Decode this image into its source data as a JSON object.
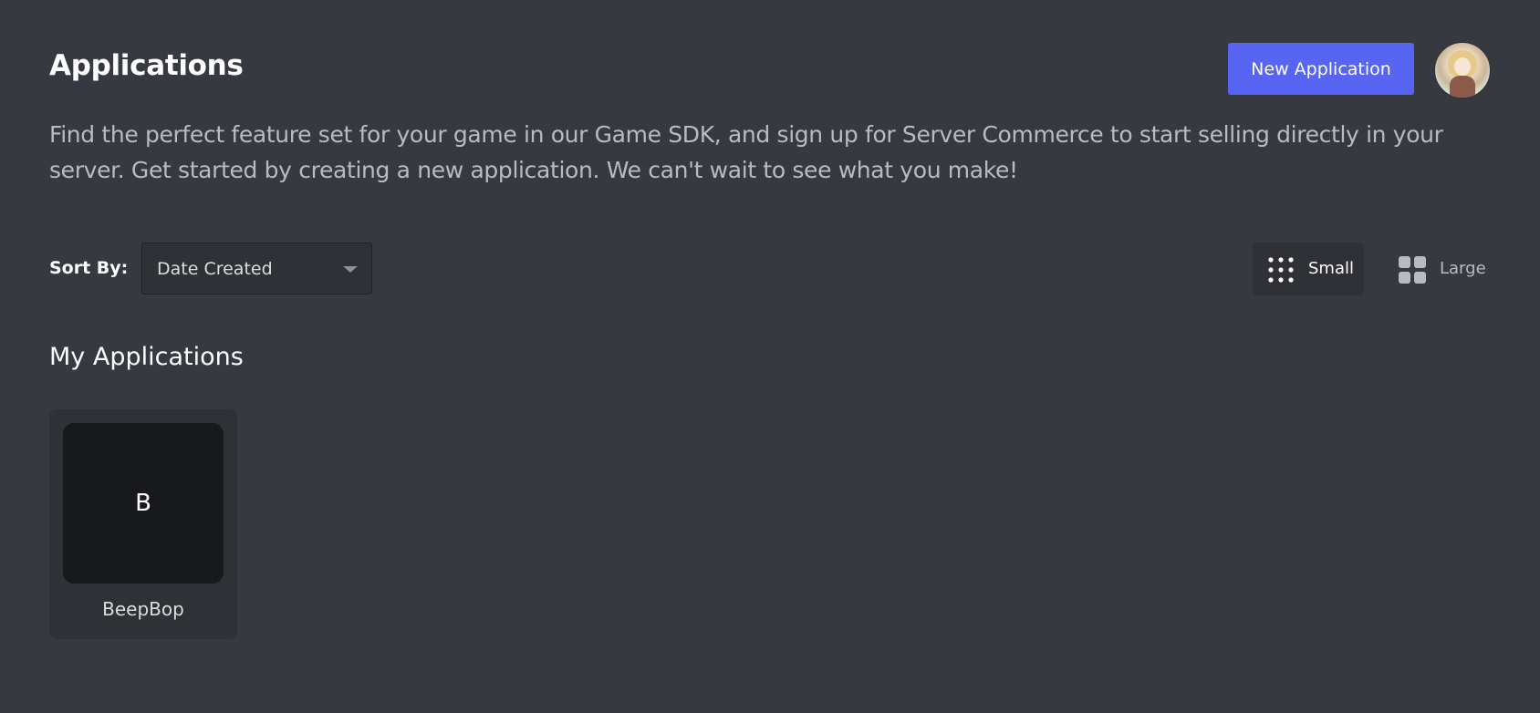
{
  "header": {
    "title": "Applications",
    "new_app_label": "New Application"
  },
  "description": "Find the perfect feature set for your game in our Game SDK, and sign up for Server Commerce to start selling directly in your server. Get started by creating a new application. We can't wait to see what you make!",
  "sort": {
    "label": "Sort By:",
    "selected": "Date Created"
  },
  "view_toggle": {
    "small_label": "Small",
    "large_label": "Large",
    "active": "Small"
  },
  "section": {
    "title": "My Applications"
  },
  "applications": [
    {
      "initial": "B",
      "name": "BeepBop"
    }
  ],
  "colors": {
    "background": "#36393f",
    "accent": "#5865f2",
    "card": "#2f3136",
    "icon_bg": "#18191c"
  }
}
